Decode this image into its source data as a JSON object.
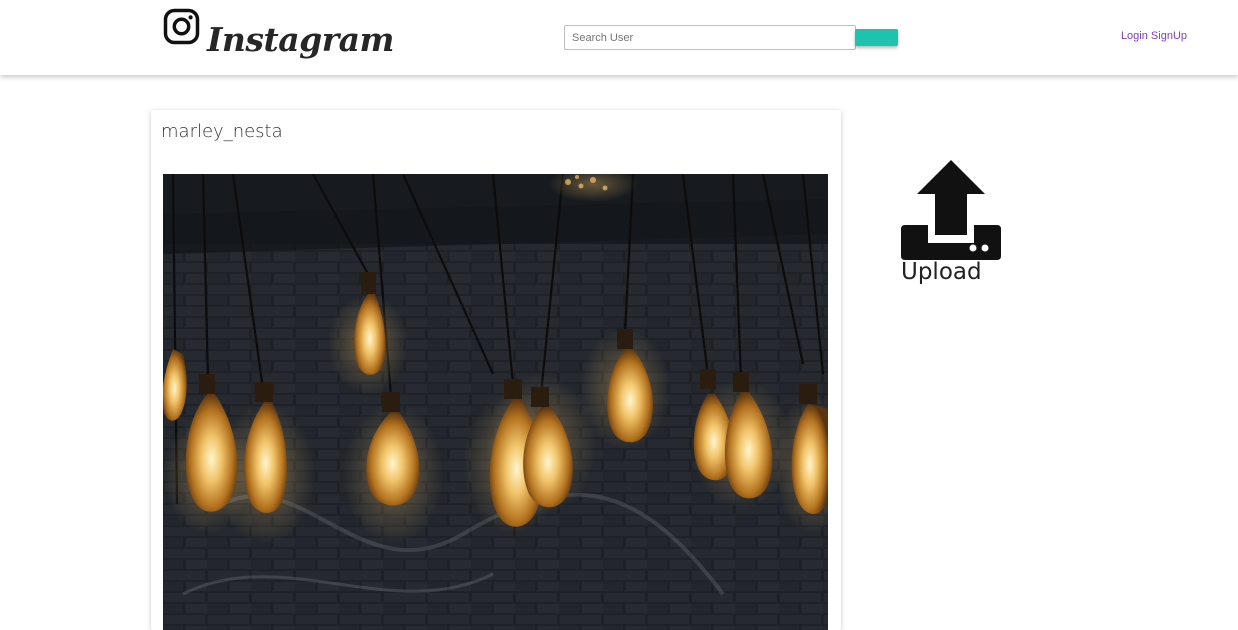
{
  "navbar": {
    "brand_name": "Instagram",
    "brand_icon": "instagram-glyph-icon",
    "search": {
      "placeholder": "Search User",
      "value": ""
    },
    "search_button_color": "#1ec2ad",
    "login_label": "Login",
    "signup_label": "SignUp",
    "link_color": "#7e3fc2"
  },
  "post": {
    "username": "marley_nesta",
    "photo_icon": "hanging-edison-bulbs-photo"
  },
  "upload": {
    "label": "Upload",
    "icon": "upload-arrow-icon"
  }
}
